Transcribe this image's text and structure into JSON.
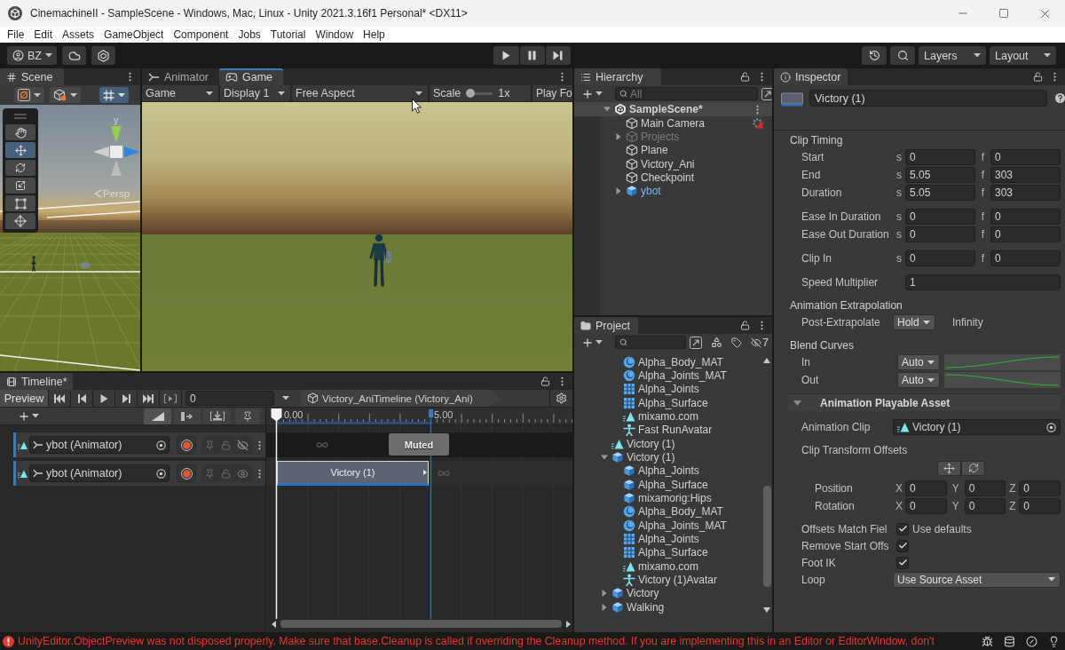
{
  "window": {
    "title": "CinemachineII - SampleScene - Windows, Mac, Linux - Unity 2021.3.16f1 Personal* <DX11>"
  },
  "menu": [
    "File",
    "Edit",
    "Assets",
    "GameObject",
    "Component",
    "Jobs",
    "Tutorial",
    "Window",
    "Help"
  ],
  "toolbar": {
    "account": "BZ",
    "layers": "Layers",
    "layout": "Layout"
  },
  "scene": {
    "tabs": [
      {
        "label": "Scene",
        "selected": true,
        "focused": false
      }
    ],
    "grid_snap": {
      "on": true
    },
    "tools": [
      {
        "kind": "hand",
        "selected": false
      },
      {
        "kind": "move",
        "selected": true
      },
      {
        "kind": "rotate",
        "selected": false
      },
      {
        "kind": "scale",
        "selected": false
      },
      {
        "kind": "rect",
        "selected": false
      },
      {
        "kind": "transform",
        "selected": false
      }
    ],
    "gizmo": {
      "axis": "y",
      "projection": "Persp"
    }
  },
  "game": {
    "tabs": [
      {
        "label": "Animator",
        "selected": false,
        "focused": false
      },
      {
        "label": "Game",
        "selected": true,
        "focused": true
      }
    ],
    "controls": [
      {
        "kind": "dropdown",
        "value": "Game"
      },
      {
        "kind": "dropdown",
        "value": "Display 1"
      },
      {
        "kind": "dropdown",
        "value": "Free Aspect"
      },
      {
        "kind": "slider",
        "label": "Scale",
        "level": 0,
        "reading": "1x"
      },
      {
        "kind": "toggle",
        "label": "Play Fo"
      }
    ]
  },
  "timeline": {
    "tabs": [
      {
        "label": "Timeline*",
        "selected": true,
        "focused": false
      }
    ],
    "preview": {
      "label": "Preview",
      "on": true
    },
    "frame": "0",
    "breadcrumb": "Victory_AniTimeline (Victory_Ani)",
    "toggles": [
      {
        "on": true
      },
      {
        "on": false
      },
      {
        "on": false
      },
      {
        "on": false
      }
    ],
    "ruler": [
      "0.00",
      "5.00"
    ],
    "tracks": [
      {
        "name": "ybot (Animator)",
        "muted": true,
        "status": "Muted"
      },
      {
        "name": "ybot (Animator)",
        "muted": false,
        "clip": "Victory (1)"
      }
    ]
  },
  "hierarchy": {
    "tabs": [
      {
        "label": "Hierarchy",
        "selected": true,
        "focused": false
      }
    ],
    "search": {
      "placeholder": "All"
    },
    "tree": [
      {
        "label": "SampleScene*",
        "kind": "scene",
        "active": true,
        "expanded": true,
        "children": [
          {
            "label": "Main Camera",
            "kind": "camera",
            "active": true
          },
          {
            "label": "Projects",
            "kind": "object",
            "active": false,
            "expanded": false
          },
          {
            "label": "Plane",
            "kind": "object",
            "active": true
          },
          {
            "label": "Victory_Ani",
            "kind": "object",
            "active": true
          },
          {
            "label": "Checkpoint",
            "kind": "object",
            "active": true
          },
          {
            "label": "ybot",
            "kind": "prefab",
            "active": true,
            "expanded": false
          }
        ]
      }
    ]
  },
  "project": {
    "tabs": [
      {
        "label": "Project",
        "selected": true,
        "focused": false
      }
    ],
    "hidden_count": "7",
    "tree": [
      {
        "children": [
          {
            "label": "Alpha_Body_MAT",
            "kind": "material"
          },
          {
            "label": "Alpha_Joints_MAT",
            "kind": "material"
          },
          {
            "label": "Alpha_Joints",
            "kind": "mesh"
          },
          {
            "label": "Alpha_Surface",
            "kind": "mesh"
          },
          {
            "label": "mixamo.com",
            "kind": "clip"
          },
          {
            "label": "Fast RunAvatar",
            "kind": "avatar"
          }
        ]
      },
      {
        "label": "Victory (1)",
        "kind": "clip"
      },
      {
        "label": "Victory (1)",
        "kind": "model",
        "expanded": true,
        "children": [
          {
            "label": "Alpha_Joints",
            "kind": "model"
          },
          {
            "label": "Alpha_Surface",
            "kind": "model"
          },
          {
            "label": "mixamorig:Hips",
            "kind": "model"
          },
          {
            "label": "Alpha_Body_MAT",
            "kind": "material"
          },
          {
            "label": "Alpha_Joints_MAT",
            "kind": "material"
          },
          {
            "label": "Alpha_Joints",
            "kind": "mesh"
          },
          {
            "label": "Alpha_Surface",
            "kind": "mesh"
          },
          {
            "label": "mixamo.com",
            "kind": "clip"
          },
          {
            "label": "Victory (1)Avatar",
            "kind": "avatar"
          }
        ]
      },
      {
        "label": "Victory",
        "kind": "model",
        "expanded": false
      },
      {
        "label": "Walking",
        "kind": "model",
        "expanded": false
      }
    ]
  },
  "inspector": {
    "tabs": [
      {
        "label": "Inspector",
        "selected": true,
        "focused": false
      }
    ],
    "name": "Victory (1)",
    "sections": [
      {
        "title": "Clip Timing",
        "groups": [
          [
            {
              "kind": "time",
              "label": "Start",
              "fields": [
                {
                  "unit": "s",
                  "value": "0"
                },
                {
                  "unit": "f",
                  "value": "0"
                }
              ]
            },
            {
              "kind": "time",
              "label": "End",
              "fields": [
                {
                  "unit": "s",
                  "value": "5.05"
                },
                {
                  "unit": "f",
                  "value": "303"
                }
              ]
            },
            {
              "kind": "time",
              "label": "Duration",
              "fields": [
                {
                  "unit": "s",
                  "value": "5.05"
                },
                {
                  "unit": "f",
                  "value": "303"
                }
              ]
            }
          ],
          [
            {
              "kind": "time",
              "label": "Ease In Duration",
              "fields": [
                {
                  "unit": "s",
                  "value": "0"
                },
                {
                  "unit": "f",
                  "value": "0"
                }
              ]
            },
            {
              "kind": "time",
              "label": "Ease Out Duration",
              "fields": [
                {
                  "unit": "s",
                  "value": "0"
                },
                {
                  "unit": "f",
                  "value": "0"
                }
              ]
            }
          ],
          [
            {
              "kind": "time",
              "label": "Clip In",
              "fields": [
                {
                  "unit": "s",
                  "value": "0"
                },
                {
                  "unit": "f",
                  "value": "0"
                }
              ]
            }
          ],
          [
            {
              "kind": "number",
              "label": "Speed Multiplier",
              "value": "1"
            }
          ]
        ]
      },
      {
        "title": "Animation Extrapolation",
        "groups": [
          [
            {
              "kind": "dropdown",
              "label": "Post-Extrapolate",
              "value": "Hold",
              "note": "Infinity"
            }
          ]
        ]
      },
      {
        "title": "Blend Curves",
        "groups": [
          [
            {
              "kind": "curve",
              "label": "In",
              "value": "Auto",
              "rising": true
            },
            {
              "kind": "curve",
              "label": "Out",
              "value": "Auto",
              "rising": false
            }
          ]
        ]
      }
    ],
    "component": {
      "title": "Animation Playable Asset",
      "expanded": true,
      "rows": [
        {
          "kind": "object",
          "label": "Animation Clip",
          "value": "Victory (1)"
        },
        {
          "kind": "caption",
          "label": "Clip Transform Offsets"
        },
        {
          "kind": "tools"
        },
        {
          "kind": "vector",
          "label": "Position",
          "fields": [
            {
              "unit": "X",
              "value": "0"
            },
            {
              "unit": "Y",
              "value": "0"
            },
            {
              "unit": "Z",
              "value": "0"
            }
          ]
        },
        {
          "kind": "vector",
          "label": "Rotation",
          "fields": [
            {
              "unit": "X",
              "value": "0"
            },
            {
              "unit": "Y",
              "value": "0"
            },
            {
              "unit": "Z",
              "value": "0"
            }
          ]
        },
        {
          "kind": "checkbox",
          "label": "Offsets Match Fiel",
          "checked": true,
          "note": "Use defaults"
        },
        {
          "kind": "checkbox",
          "label": "Remove Start Offs",
          "checked": true
        },
        {
          "kind": "checkbox",
          "label": "Foot IK",
          "checked": true
        },
        {
          "kind": "popup",
          "label": "Loop",
          "value": "Use Source Asset"
        }
      ]
    }
  },
  "status": {
    "error": true,
    "message": "UnityEditor.ObjectPreview was not disposed properly. Make sure that base.Cleanup is called if overriding the Cleanup method. If you are implementing this in an Editor or EditorWindow, don't"
  }
}
